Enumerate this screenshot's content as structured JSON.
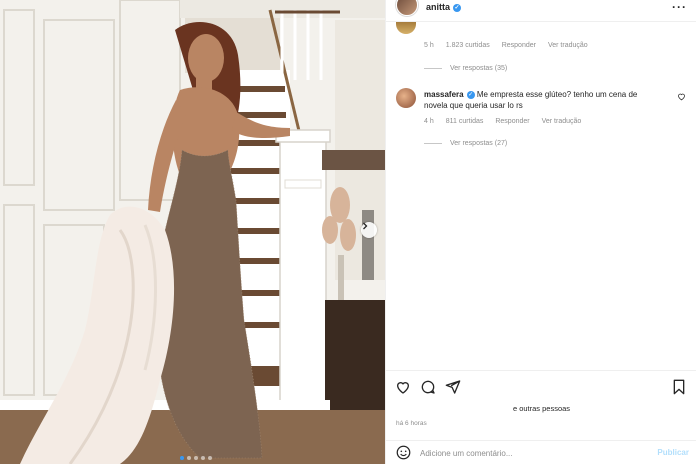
{
  "header": {
    "username": "anitta",
    "more_label": "···"
  },
  "comment_prev": {
    "time": "5 h",
    "likes": "1.823 curtidas",
    "reply": "Responder",
    "translate": "Ver tradução",
    "view_replies": "Ver respostas (35)"
  },
  "comment": {
    "username": "massafera",
    "text": "Me empresta esse glúteo? tenho um cena de novela que queria usar lo rs",
    "time": "4 h",
    "likes": "811 curtidas",
    "reply": "Responder",
    "translate": "Ver tradução",
    "view_replies": "Ver respostas (27)"
  },
  "likes_text": "e outras pessoas",
  "post_time": "há 6 horas",
  "add_comment": {
    "placeholder": "Adicione um comentário...",
    "publish": "Publicar"
  },
  "icons": [
    "heart-icon",
    "comment-icon",
    "share-icon",
    "bookmark-icon",
    "emoji-icon",
    "verified-icon",
    "chevron-right-icon"
  ],
  "colors": {
    "accent": "#3897f0",
    "muted": "#8e8e8e",
    "text": "#262626",
    "publish_disabled": "#b2dffc"
  }
}
